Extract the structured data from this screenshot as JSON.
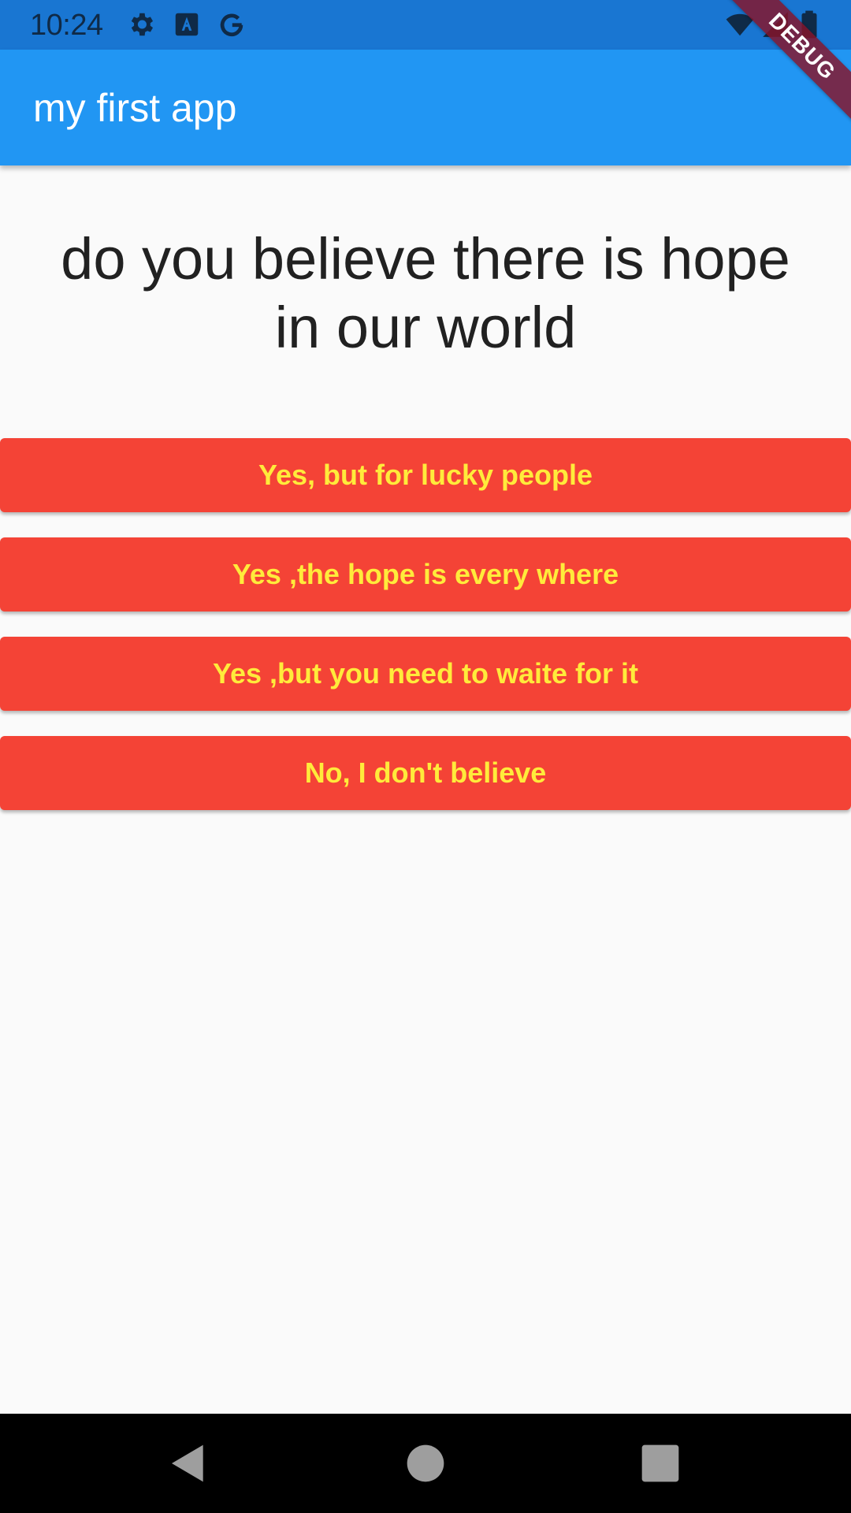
{
  "status_bar": {
    "time": "10:24",
    "icons": [
      "settings-gear-icon",
      "font-a-icon",
      "google-g-icon",
      "wifi-icon",
      "signal-icon",
      "battery-icon"
    ],
    "background_color": "#1976d2"
  },
  "app_bar": {
    "title": "my first app",
    "background_color": "#2196f3"
  },
  "debug_banner": {
    "label": "DEBUG"
  },
  "question": {
    "text": "do you believe there is hope in our world"
  },
  "answers": [
    {
      "label": "Yes, but for lucky people"
    },
    {
      "label": "Yes ,the hope is every where"
    },
    {
      "label": "Yes ,but you need to waite for it"
    },
    {
      "label": "No, I don't believe"
    }
  ],
  "colors": {
    "button_background": "#f44336",
    "button_text": "#ffeb3b",
    "page_background": "#fafafa"
  },
  "nav_bar": {
    "buttons": [
      "back-icon",
      "home-icon",
      "recents-icon"
    ]
  }
}
